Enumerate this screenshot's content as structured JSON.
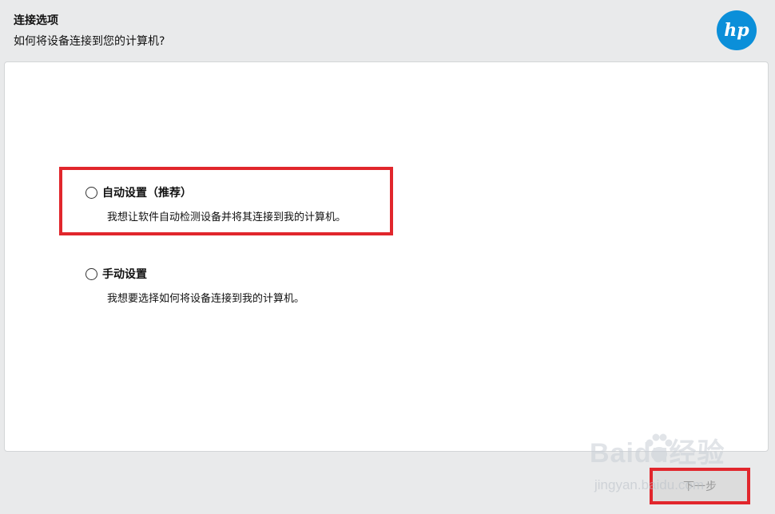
{
  "header": {
    "title": "连接选项",
    "subtitle": "如何将设备连接到您的计算机?",
    "logo_text": "hp",
    "logo_color": "#0b8fd9"
  },
  "options": [
    {
      "label": "自动设置（推荐）",
      "description": "我想让软件自动检测设备并将其连接到我的计算机。",
      "selected": false
    },
    {
      "label": "手动设置",
      "description": "我想要选择如何将设备连接到我的计算机。",
      "selected": false
    }
  ],
  "footer": {
    "next_label": "下一步"
  },
  "watermark": {
    "main": "Baidu经验",
    "sub": "jingyan.baidu.com"
  },
  "colors": {
    "highlight": "#e1262c",
    "background": "#e9eaeb"
  }
}
